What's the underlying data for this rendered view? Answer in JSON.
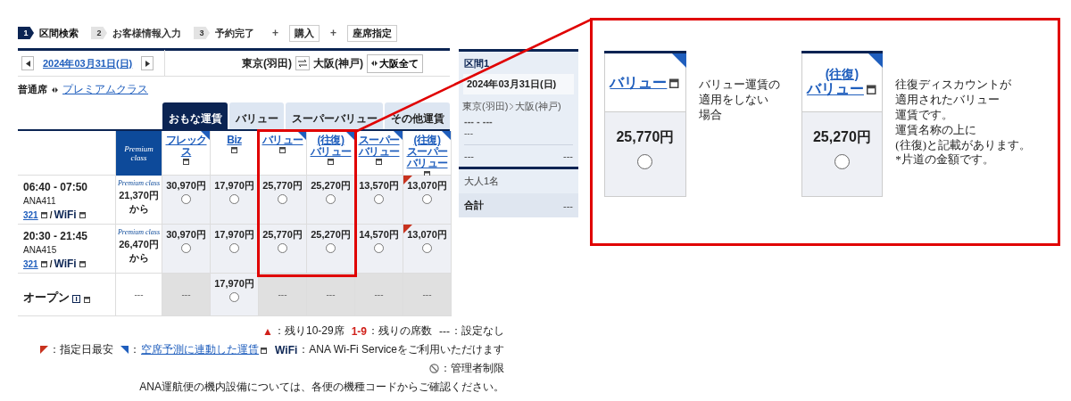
{
  "steps": [
    {
      "number": "1",
      "label": "区間検索",
      "selected": true
    },
    {
      "number": "2",
      "label": "お客様情報入力",
      "selected": false
    },
    {
      "number": "3",
      "label": "予約完了",
      "selected": false
    }
  ],
  "step_extras": [
    {
      "plus": "+",
      "label": "購入"
    },
    {
      "plus": "+",
      "label": "座席指定"
    }
  ],
  "date_nav": {
    "date": "2024年03月31日(日)"
  },
  "route": {
    "from": "東京(羽田)",
    "to": "大阪(神戸)",
    "all_button": "大阪全て"
  },
  "cabin": {
    "current": "普通席",
    "other": "プレミアムクラス"
  },
  "fare_tabs": [
    {
      "label": "おもな運賃",
      "selected": true
    },
    {
      "label": "バリュー",
      "selected": false
    },
    {
      "label": "スーパーバリュー",
      "selected": false
    },
    {
      "label": "その他運賃",
      "selected": false
    }
  ],
  "premium_header": "Premium class",
  "columns": [
    {
      "label": "フレックス",
      "dynamic": true
    },
    {
      "label": "Biz",
      "dynamic": false
    },
    {
      "label": "バリュー",
      "dynamic": true
    },
    {
      "prefix": "(往復)",
      "label": "バリュー",
      "dynamic": true
    },
    {
      "label": "スーパーバリュー",
      "dynamic": true
    },
    {
      "prefix": "(往復)",
      "label": "スーパーバリュー",
      "dynamic": true
    }
  ],
  "flights": [
    {
      "time": "06:40 - 07:50",
      "flight": "ANA411",
      "aircraft": "321",
      "separator": "/",
      "wifi": "WiFi",
      "premium_label": "Premium class",
      "premium_price": "21,370円",
      "premium_suffix": "から",
      "fares": [
        {
          "price": "30,970円",
          "best": false,
          "selected": false
        },
        {
          "price": "17,970円",
          "best": false,
          "selected": false
        },
        {
          "price": "25,770円",
          "best": false,
          "selected": false
        },
        {
          "price": "25,270円",
          "best": false,
          "selected": false
        },
        {
          "price": "13,570円",
          "best": false,
          "selected": false
        },
        {
          "price": "13,070円",
          "best": true,
          "selected": false
        }
      ]
    },
    {
      "time": "20:30 - 21:45",
      "flight": "ANA415",
      "aircraft": "321",
      "separator": "/",
      "wifi": "WiFi",
      "premium_label": "Premium class",
      "premium_price": "26,470円",
      "premium_suffix": "から",
      "fares": [
        {
          "price": "30,970円",
          "best": false,
          "selected": false
        },
        {
          "price": "17,970円",
          "best": false,
          "selected": false
        },
        {
          "price": "25,770円",
          "best": false,
          "selected": false
        },
        {
          "price": "25,270円",
          "best": false,
          "selected": false
        },
        {
          "price": "14,570円",
          "best": false,
          "selected": false
        },
        {
          "price": "13,070円",
          "best": true,
          "selected": false
        }
      ]
    }
  ],
  "open_row": {
    "label": "オープン",
    "premium": "---",
    "fares": [
      {
        "price": "---",
        "available": false
      },
      {
        "price": "17,970円",
        "available": true,
        "selected": false
      },
      {
        "price": "---",
        "available": false
      },
      {
        "price": "---",
        "available": false
      },
      {
        "price": "---",
        "available": false
      },
      {
        "price": "---",
        "available": false
      }
    ]
  },
  "legend": [
    [
      {
        "kind": "triangle",
        "mark": "▲",
        "text": "：残り10-29席"
      },
      {
        "kind": "count",
        "mark": "1-9",
        "text": "：残りの席数"
      },
      {
        "kind": "plain",
        "mark": "---",
        "text": "：設定なし"
      }
    ],
    [
      {
        "kind": "best_corner",
        "text": "：指定日最安"
      },
      {
        "kind": "dynamic_corner",
        "text": "：",
        "link": "空席予測に連動した運賃"
      },
      {
        "kind": "wifi",
        "mark": "WiFi",
        "text": "：ANA Wi-Fi Serviceをご利用いただけます"
      }
    ],
    [
      {
        "kind": "restricted",
        "text": "：管理者制限"
      }
    ],
    [
      {
        "kind": "note",
        "text": "ANA運航便の機内設備については、各便の機種コードからご確認ください。"
      }
    ]
  ],
  "summary": {
    "title": "区間1",
    "date": "2024年03月31日(日)",
    "from": "東京(羽田)",
    "to": "大阪(神戸)",
    "times": "--- - ---",
    "flight": "---",
    "fare": "---",
    "fare_price": "---",
    "passengers": "大人1名",
    "total_label": "合計",
    "total": "---"
  },
  "callout": [
    {
      "label": "バリュー",
      "price": "25,770円",
      "selected": false,
      "description": [
        "バリュー運賃の",
        "適用をしない",
        "場合"
      ]
    },
    {
      "prefix": "(往復)",
      "label": "バリュー",
      "price": "25,270円",
      "selected": false,
      "description": [
        "往復ディスカウントが",
        "適用されたバリュー",
        "運賃です。",
        "運賃名称の上に",
        "(往復)と記載があります。",
        "*片道の金額です。"
      ]
    }
  ]
}
